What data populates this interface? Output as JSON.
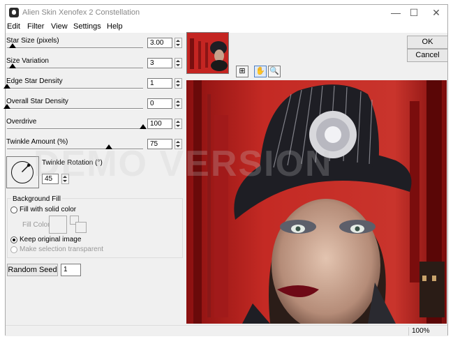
{
  "window": {
    "title": "Alien Skin Xenofex 2 Constellation",
    "min": "—",
    "max": "☐",
    "close": "✕"
  },
  "menu": [
    "Edit",
    "Filter",
    "View",
    "Settings",
    "Help"
  ],
  "params": [
    {
      "label": "Star Size (pixels)",
      "value": "3.00",
      "slider": 0.04
    },
    {
      "label": "Size Variation",
      "value": "3",
      "slider": 0.04
    },
    {
      "label": "Edge Star Density",
      "value": "1",
      "slider": 0.0
    },
    {
      "label": "Overall Star Density",
      "value": "0",
      "slider": 0.0
    },
    {
      "label": "Overdrive",
      "value": "100",
      "slider": 1.0
    },
    {
      "label": "Twinkle Amount (%)",
      "value": "75",
      "slider": 0.75
    }
  ],
  "twinkle_rotation": {
    "label": "Twinkle Rotation (°)",
    "value": "45"
  },
  "background_fill": {
    "title": "Background Fill",
    "solid": "Fill with solid color",
    "fill_color": "Fill Color",
    "keep": "Keep original image",
    "transparent": "Make selection transparent"
  },
  "random_seed": {
    "label": "Random Seed",
    "value": "1"
  },
  "buttons": {
    "ok": "OK",
    "cancel": "Cancel"
  },
  "status": {
    "zoom": "100%"
  },
  "watermark": "DEMO VERSION",
  "colors": {
    "preview_red": "#b11a1a",
    "hat": "#1e1e24"
  }
}
